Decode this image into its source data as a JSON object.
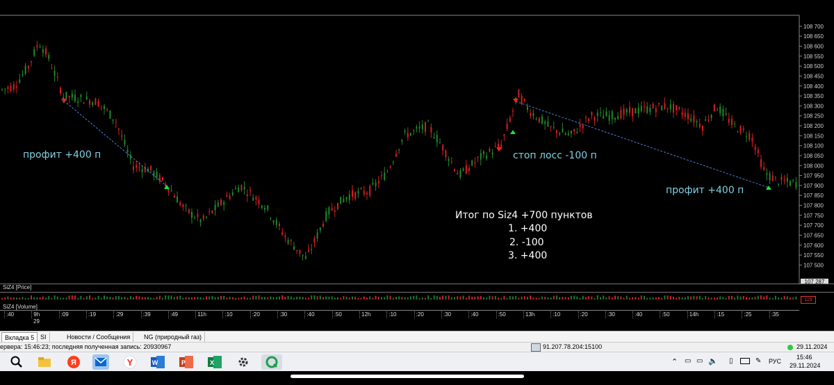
{
  "chart": {
    "y_labels": [
      "108 700",
      "108 650",
      "108 600",
      "108 550",
      "108 500",
      "108 450",
      "108 400",
      "108 350",
      "108 300",
      "108 250",
      "108 200",
      "108 150",
      "108 100",
      "108 050",
      "108 000",
      "107 950",
      "107 900",
      "107 850",
      "107 800",
      "107 750",
      "107 700",
      "107 650",
      "107 600",
      "107 550",
      "107 500"
    ],
    "y_min": 107470,
    "y_max": 108710,
    "current_price": "107 287",
    "annotations": {
      "profit_left": "профит +400 п",
      "stop_loss": "стоп лосс -100 п",
      "profit_right": "профит +400 п",
      "summary_title": "Итог по Siz4 +700 пунктов",
      "summary_1": "1. +400",
      "summary_2": "2. -100",
      "summary_3": "3. +400"
    },
    "colors": {
      "up": "#1f8a2a",
      "down": "#d42020",
      "trend_line": "#4a7fd0",
      "annotation": "#7fd0e0",
      "marker_sell": "#ff2020",
      "marker_buy": "#20e040"
    }
  },
  "panels": {
    "price_label": "SiZ4 [Price]",
    "volume_label": "SiZ4 [Volume]",
    "volume_value": "119"
  },
  "time_axis": {
    "ticks": [
      ":40",
      "9h",
      ":09",
      ":19",
      ":29",
      ":39",
      ":49",
      "11h",
      ":10",
      ":20",
      ":30",
      ":40",
      ":50",
      "12h",
      ":10",
      ":20",
      ":30",
      ":40",
      ":50",
      "13h",
      ":10",
      ":20",
      ":30",
      ":40",
      ":50",
      "14h",
      ":15",
      ":25",
      ":35"
    ],
    "date": "29"
  },
  "tabs": [
    "Вкладка 5",
    "SI",
    "Новости / Сообщения",
    "NG (природный газ)"
  ],
  "status": {
    "left": "ервера: 15:46:23; последняя полученная запись: 20930967",
    "server": "91.207.78.204:15100",
    "date": "29.11.2024"
  },
  "taskbar": {
    "lang": "РУС",
    "time": "15:46",
    "date": "29.11.2024"
  }
}
